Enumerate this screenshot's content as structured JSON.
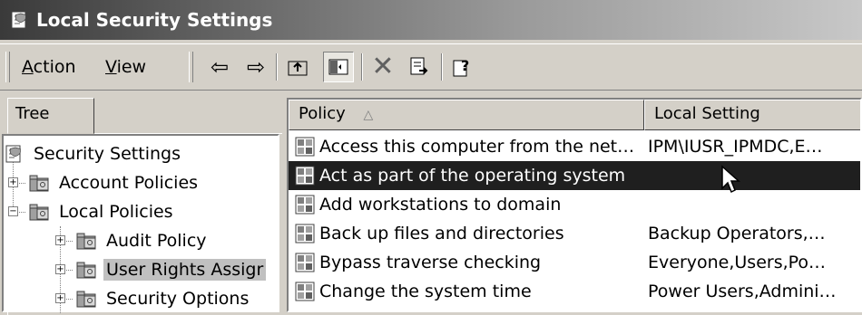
{
  "window": {
    "title": "Local Security Settings",
    "icon": "security-settings-icon"
  },
  "menu": {
    "action": "Action",
    "view": "View"
  },
  "toolbar_icons": [
    "back-arrow-icon",
    "forward-arrow-icon",
    "up-one-level-icon",
    "show-hide-tree-icon",
    "delete-icon",
    "export-list-icon",
    "help-icon"
  ],
  "tree": {
    "tab_label": "Tree",
    "nodes": [
      {
        "label": "Security Settings",
        "icon": "security-settings-icon"
      },
      {
        "label": "Account Policies",
        "icon": "folder-icon"
      },
      {
        "label": "Local Policies",
        "icon": "folder-icon"
      },
      {
        "label": "Audit Policy",
        "icon": "folder-icon"
      },
      {
        "label": "User Rights Assigr",
        "icon": "folder-icon",
        "selected": true
      },
      {
        "label": "Security Options",
        "icon": "folder-icon"
      }
    ]
  },
  "list": {
    "columns": [
      "Policy",
      "Local Setting"
    ],
    "sort_indicator": "△",
    "rows": [
      {
        "policy": "Access this computer from the net…",
        "setting": "IPM\\IUSR_IPMDC,E…"
      },
      {
        "policy": "Act as part of the operating system",
        "setting": "",
        "selected": true
      },
      {
        "policy": "Add workstations to domain",
        "setting": ""
      },
      {
        "policy": "Back up files and directories",
        "setting": "Backup Operators,…"
      },
      {
        "policy": "Bypass traverse checking",
        "setting": "Everyone,Users,Po…"
      },
      {
        "policy": "Change the system time",
        "setting": "Power Users,Admini…"
      }
    ]
  },
  "colors": {
    "face": "#d4d0c8",
    "selection": "#1f1f1f",
    "title_start": "#3a3a3a"
  }
}
